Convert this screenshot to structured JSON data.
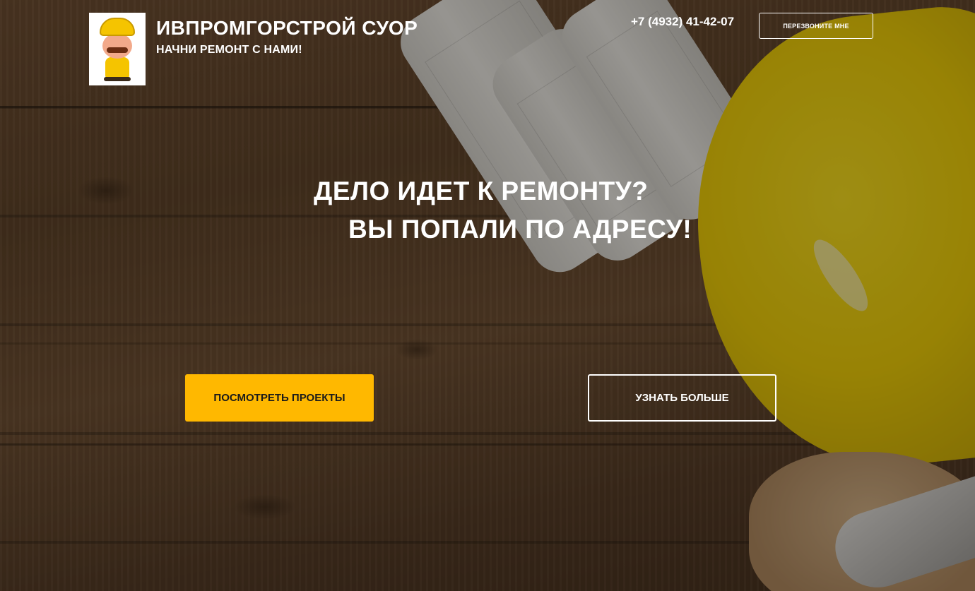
{
  "header": {
    "brand_title": "ИВПРОМГОРСТРОЙ СУОР",
    "brand_subtitle": "НАЧНИ РЕМОНТ С НАМИ!",
    "phone": "+7 (4932) 41-42-07",
    "callback_label": "ПЕРЕЗВОНИТЕ МНЕ"
  },
  "hero": {
    "headline_line1": "ДЕЛО ИДЕТ К РЕМОНТУ?",
    "headline_line2": "ВЫ ПОПАЛИ ПО АДРЕСУ!",
    "primary_button_label": "ПОСМОТРЕТЬ ПРОЕКТЫ",
    "secondary_button_label": "УЗНАТЬ БОЛЬШЕ"
  },
  "colors": {
    "accent": "#ffb800",
    "text": "#ffffff",
    "button_text_dark": "#1a1a1a"
  },
  "icons": {
    "logo": "builder-mascot-icon"
  }
}
